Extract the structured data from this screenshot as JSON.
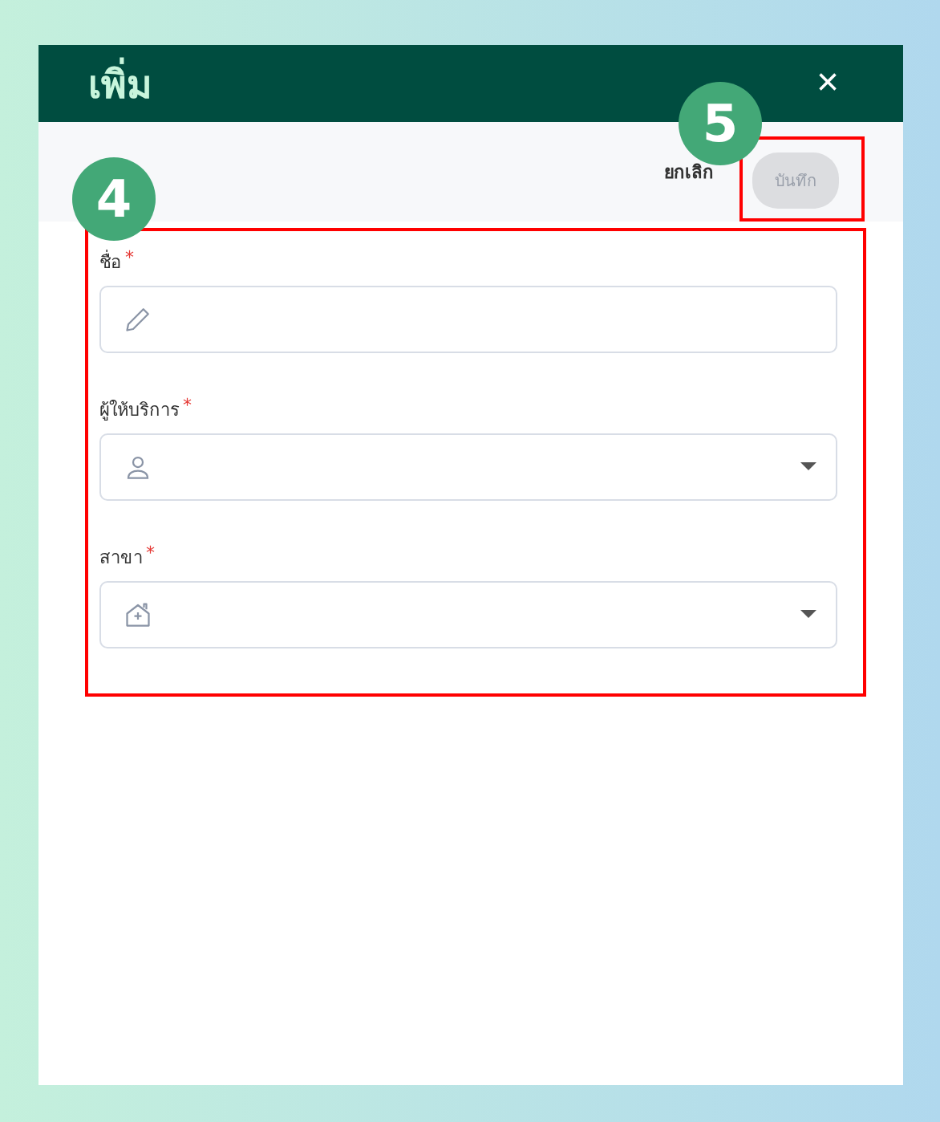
{
  "dialog": {
    "title": "เพิ่ม",
    "close": "×"
  },
  "toolbar": {
    "cancel": "ยกเลิก",
    "save": {
      "label": "บันทึก",
      "disabled": true,
      "callout": "5"
    }
  },
  "form": {
    "callout": "4",
    "fields": [
      {
        "label": "ชื่อ",
        "required_mark": "*",
        "kind": "text"
      },
      {
        "label": "ผู้ให้บริการ",
        "required_mark": "*",
        "kind": "select"
      },
      {
        "label": "สาขา",
        "required_mark": "*",
        "kind": "select"
      }
    ]
  }
}
